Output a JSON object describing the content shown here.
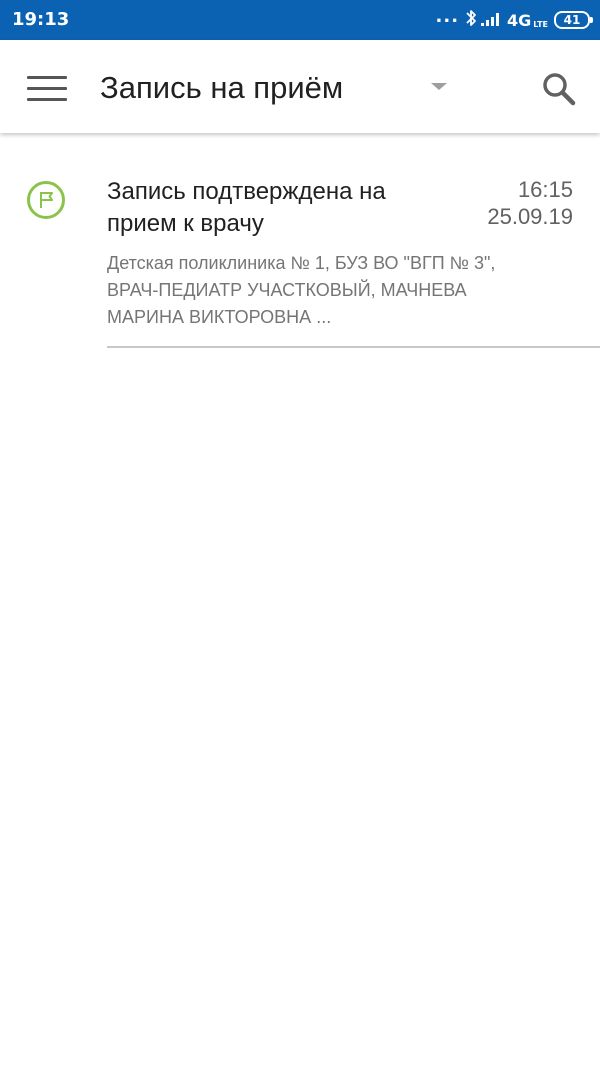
{
  "status_bar": {
    "time": "19:13",
    "dots": "...",
    "network": "4G",
    "network_sub": "LTE",
    "battery": "41"
  },
  "app_bar": {
    "title": "Запись на приём",
    "menu_icon": "hamburger-menu-icon",
    "dropdown_icon": "dropdown-arrow-icon",
    "search_icon": "search-icon"
  },
  "notifications": [
    {
      "icon": "flag-icon",
      "title": "Запись подтверждена на прием к врачу",
      "time": "16:15",
      "date": "25.09.19",
      "description": "Детская поликлиника № 1, БУЗ ВО \"ВГП № 3\", ВРАЧ-ПЕДИАТР УЧАСТКОВЫЙ, МАЧНЕВА МАРИНА ВИКТОРОВНА ..."
    }
  ],
  "colors": {
    "status_bar": "#0c62b2",
    "flag_icon": "#8bc34a",
    "title_text": "#212121",
    "secondary_text": "#757575"
  }
}
